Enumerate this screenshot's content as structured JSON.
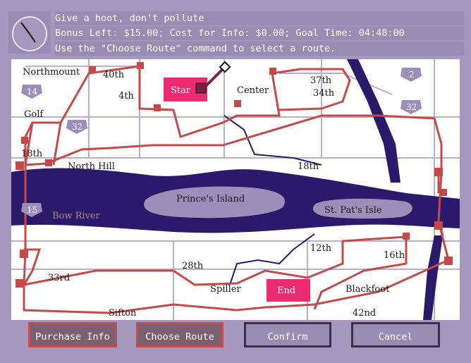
{
  "messages": {
    "line1": "Give a hoot, don't pollute",
    "line2": "Bonus Left: $15.00; Cost for Info: $0.00; Goal Time: 04:48:00",
    "line3": "Use the \"Choose Route\" command to select a route."
  },
  "buttons": {
    "purchase_info": "Purchase Info",
    "choose_route": "Choose Route",
    "confirm": "Confirm",
    "cancel": "Cancel"
  },
  "map": {
    "start_label": "Star",
    "end_label": "End",
    "river_label": "Bow River",
    "islands": {
      "princes": "Prince's Island",
      "st_pats": "St. Pat's Isle"
    },
    "highways": [
      "14",
      "32",
      "15",
      "2",
      "32"
    ],
    "streets": {
      "northmount": "Northmount",
      "s40th": "40th",
      "s4th": "4th",
      "center": "Center",
      "s37th": "37th",
      "s34th": "34th",
      "golf": "Golf",
      "s18th_w": "18th",
      "north_hill": "North Hill",
      "s18th_e": "18th",
      "s12th": "12th",
      "s16th": "16th",
      "s33rd": "33rd",
      "s28th": "28th",
      "spiller": "Spiller",
      "blackfoot": "Blackfoot",
      "sifton": "Sifton",
      "s42nd": "42nd"
    }
  },
  "colors": {
    "map_bg": "#ffffff",
    "river": "#2b1a6b",
    "island": "#9b8fba",
    "road_grid": "#b8aed0",
    "route": "#c44a4a",
    "start_end": "#ec2c6f",
    "chrome": "#a597bd"
  }
}
